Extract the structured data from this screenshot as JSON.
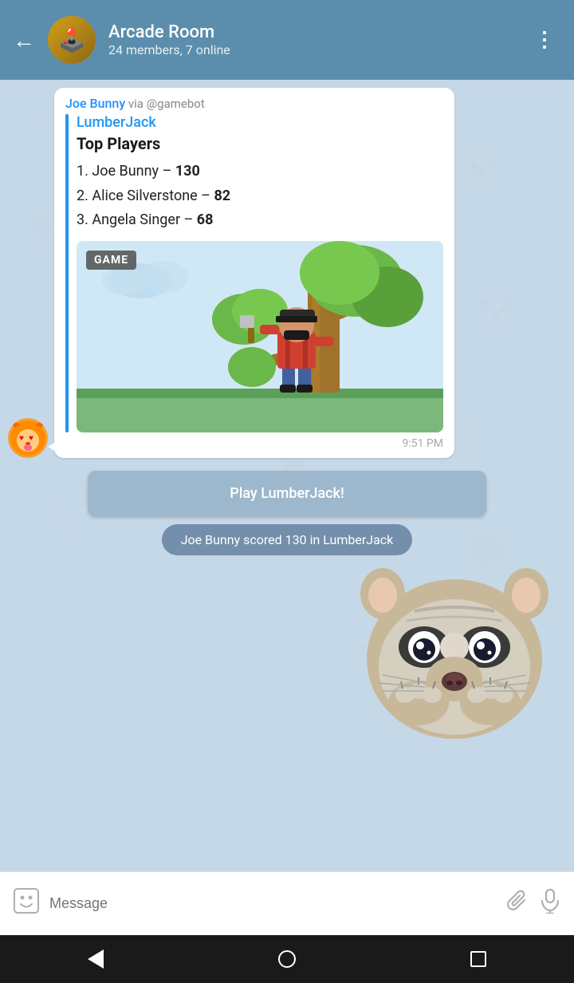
{
  "header": {
    "title": "Arcade Room",
    "subtitle": "24 members, 7 online",
    "back_label": "←",
    "more_label": "⋮",
    "avatar_emoji": "🕹️"
  },
  "message": {
    "sender": "Joe Bunny",
    "via": " via @gamebot",
    "game_name": "LumberJack",
    "top_players_title": "Top Players",
    "players": [
      {
        "rank": "1",
        "name": "Joe Bunny",
        "score": "130"
      },
      {
        "rank": "2",
        "name": "Alice Silverstone",
        "score": "82"
      },
      {
        "rank": "3",
        "name": "Angela Singer",
        "score": "68"
      }
    ],
    "game_badge": "GAME",
    "time": "9:51 PM"
  },
  "play_button": {
    "label": "Play LumberJack!"
  },
  "score_notification": {
    "text": "Joe Bunny scored 130 in LumberJack"
  },
  "bottom_bar": {
    "placeholder": "Message"
  },
  "icons": {
    "emoji": "😊",
    "attach": "📎",
    "mic": "🎤"
  }
}
